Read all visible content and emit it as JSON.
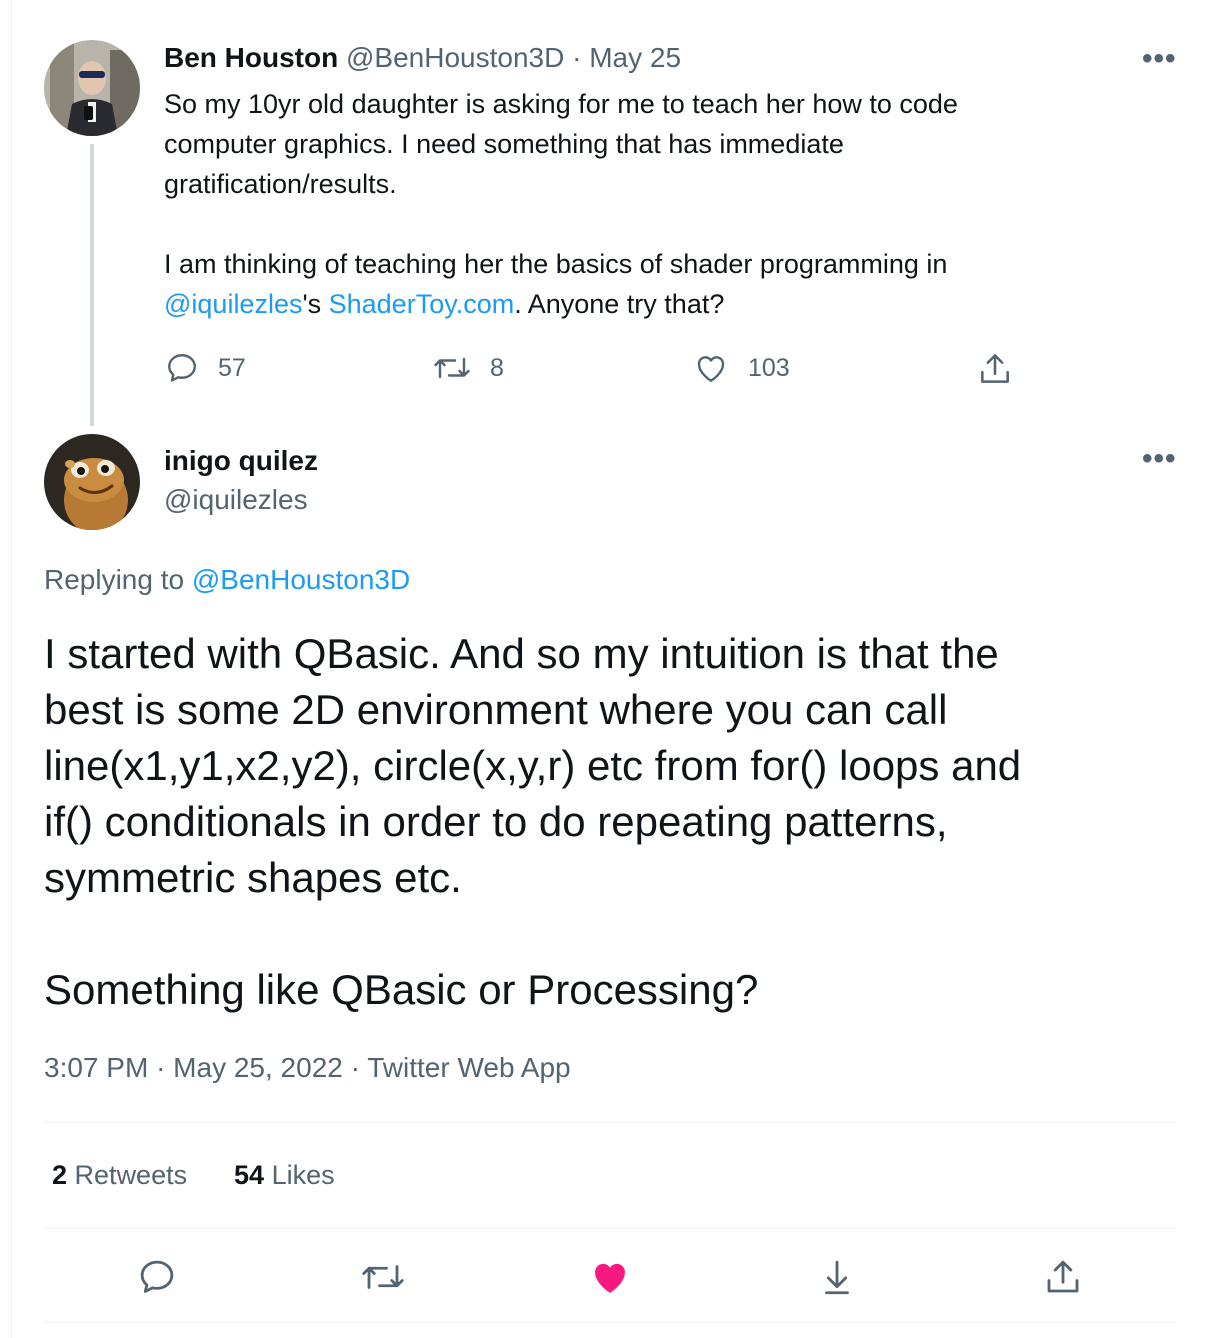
{
  "parent_tweet": {
    "author_name": "Ben Houston",
    "author_handle": "@BenHouston3D",
    "separator": "·",
    "date": "May 25",
    "line1": "So my 10yr old daughter is asking for me to teach her how to code",
    "line2": "computer graphics.  I need something that has immediate",
    "line3": "gratification/results.",
    "line4": "I am thinking of teaching her the basics of shader programming in",
    "mention": "@iquilezles",
    "possessive": "'s ",
    "site_link": "ShaderToy.com",
    "tail": ".  Anyone try that?",
    "reply_count": "57",
    "retweet_count": "8",
    "like_count": "103",
    "more_label": "•••"
  },
  "main_tweet": {
    "author_name": "inigo quilez",
    "author_handle": "@iquilezles",
    "more_label": "•••",
    "replying_prefix": "Replying to",
    "replying_handle": "@BenHouston3D",
    "text_p1": "I started with QBasic. And so my intuition is that the\nbest is some 2D environment where you can call\nline(x1,y1,x2,y2), circle(x,y,r) etc from for() loops and\nif() conditionals in order to do repeating patterns,\nsymmetric shapes etc.",
    "text_p2": "Something like QBasic or Processing?",
    "time": "3:07 PM",
    "sep1": "·",
    "date": "May 25, 2022",
    "sep2": "·",
    "source": "Twitter Web App",
    "retweets_count": "2",
    "retweets_label": "Retweets",
    "likes_count": "54",
    "likes_label": "Likes"
  },
  "icons": {
    "reply": "reply-icon",
    "retweet": "retweet-icon",
    "like": "heart-icon",
    "liked": "heart-filled-icon",
    "bookmark": "bookmark-download-icon",
    "share": "share-icon"
  },
  "colors": {
    "link": "#1d9bf0",
    "muted": "#536471",
    "like_active": "#f91880",
    "divider": "#eff3f4"
  }
}
